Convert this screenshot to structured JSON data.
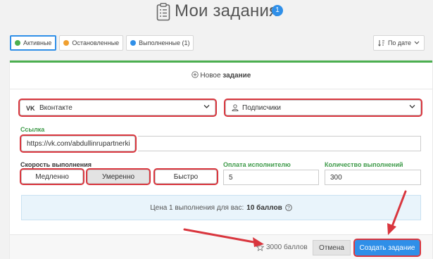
{
  "header": {
    "title": "Мои задания",
    "badge": "1"
  },
  "tabs": [
    {
      "label": "Активные",
      "color": "#4caf50"
    },
    {
      "label": "Остановленные",
      "color": "#f0a030"
    },
    {
      "label": "Выполненные (1)",
      "color": "#2f8fe8"
    }
  ],
  "sort": {
    "label": "По дате"
  },
  "card": {
    "new_task_prefix": "Новое",
    "new_task_bold": "задание",
    "network_select": "Вконтакте",
    "type_select": "Подписчики",
    "link_label": "Ссылка",
    "link_value": "https://vk.com/abdullinrupartnerki",
    "speed_label": "Скорость выполнения",
    "speed_options": [
      "Медленно",
      "Умеренно",
      "Быстро"
    ],
    "payment_label": "Оплата исполнителю",
    "payment_value": "5",
    "count_label": "Количество выполнений",
    "count_value": "300",
    "price_text": "Цена 1 выполнения для вас:",
    "price_value": "10 баллов"
  },
  "footer": {
    "points": "3000 баллов",
    "cancel": "Отмена",
    "create": "Создать задание"
  },
  "colors": {
    "accent": "#2f8fe8",
    "highlight": "#d9363e",
    "success": "#4caf50"
  },
  "icons": [
    "clipboard-icon",
    "vk-icon",
    "user-icon",
    "chevron-down-icon",
    "sort-icon",
    "plus-circle-icon",
    "help-icon",
    "star-icon"
  ]
}
